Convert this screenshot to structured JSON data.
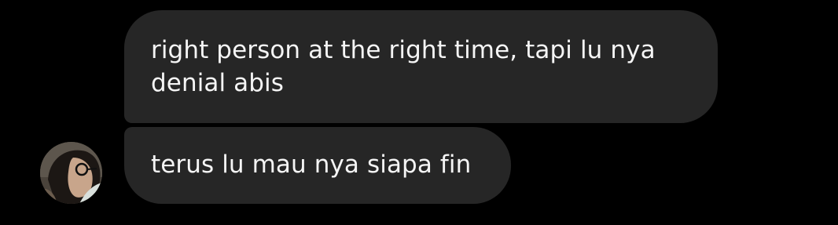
{
  "conversation": {
    "messages": [
      {
        "text": "right person at the right time, tapi lu nya denial abis"
      },
      {
        "text": "terus lu mau nya siapa fin"
      }
    ]
  },
  "colors": {
    "background": "#000000",
    "bubble": "#262626",
    "text": "#f5f5f5"
  }
}
